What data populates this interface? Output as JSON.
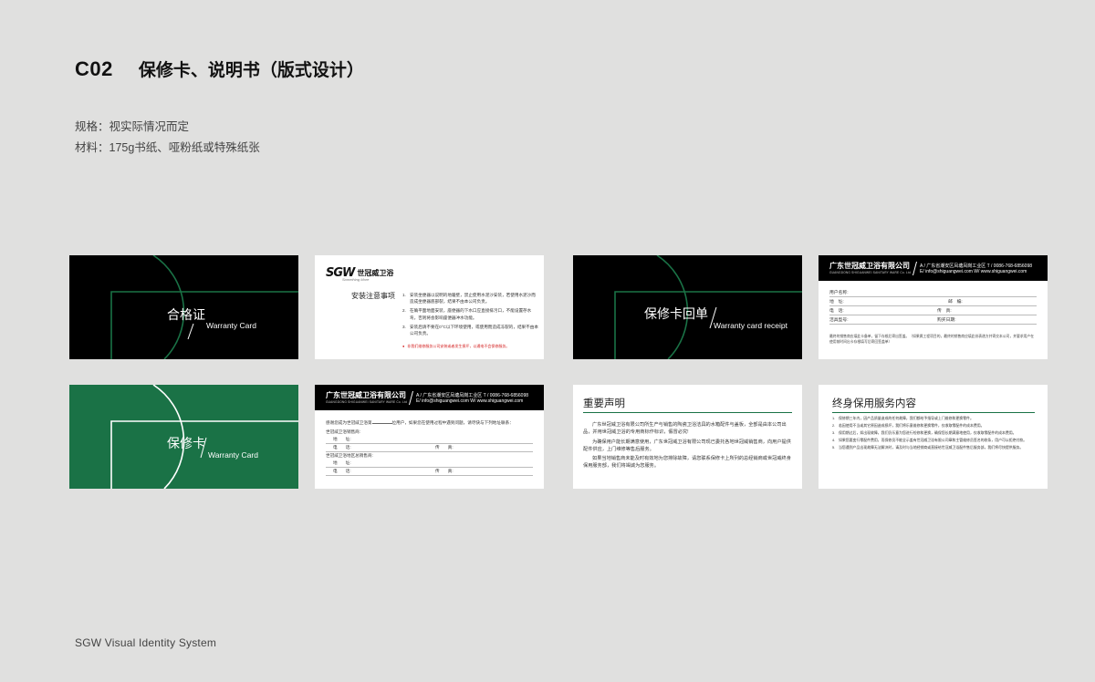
{
  "header": {
    "code": "C02",
    "title": "保修卡、说明书（版式设计）"
  },
  "specs": {
    "size": "规格：视实际情况而定",
    "material": "材料：175g书纸、哑粉纸或特殊纸张"
  },
  "footer": "SGW Visual Identity System",
  "company": {
    "name_cn": "广东世冠威卫浴有限公司",
    "name_en": "GUANGDONG SHIGUANWEI SANITARY WARE Co. Ltd",
    "address": "A / 广东省潮安区凤塘凤岗工业区  T / 0086-768-6856098",
    "web": "E/ info@shiguangwei.com  W/ www.shiguangwei.com"
  },
  "colors": {
    "brand_green": "#1a7246",
    "black": "#000000",
    "warning_red": "#d42222"
  },
  "cards": {
    "certificate": {
      "cn": "合格证",
      "en": "Warranty Card"
    },
    "receipt": {
      "cn": "保修卡回单",
      "en": "Warranty card receipt"
    },
    "warranty": {
      "cn": "保修卡",
      "en": "Warranty Card"
    },
    "install": {
      "logo_mark": "SGW",
      "logo_name": "世冠威卫浴",
      "logo_sub": "Something More",
      "title": "安装注意事项",
      "items": [
        {
          "num": "1.",
          "text": "安装坐便器以说明的地暖壁，禁止使用水泥沙安装，若使用水泥沙而造成坐便器底部裂，结果不由本公司负责。"
        },
        {
          "num": "2.",
          "text": "在确平面地面安装，座便器的下水口应直接排污口，不能设置存水弯，否则将会影响座便器冲水功能。"
        },
        {
          "num": "3.",
          "text": "安装后请不要在0°C以下环境使用，或使用而造成冻裂的，结果不由本公司负责。"
        }
      ],
      "warning": "非我们维修服务公司安装或者发生损坏，以通电不会保修服务。"
    },
    "receipt_form": {
      "rows": [
        [
          "用户名称:",
          ""
        ],
        [
          "地　址:",
          "邮　编:"
        ],
        [
          "电　话:",
          "传　真:"
        ],
        [
          "洁具型号:",
          "购买日期:"
        ]
      ],
      "note": "最终的销售商应填此卡备单，留下存根后寄出签盖。（如果属工程项目的，最终的销售商应填此份表递方并寄交本公司，并要求用户在使用前时间出卡存根填写后寄回签盖单）"
    },
    "warranty_form": {
      "intro_a": "感谢您成为世冠威卫浴第",
      "intro_b": "位用户，如果您在使用过程中遇到问题，请尽快与下列地址联系：",
      "dealer_title": "世冠威卫浴销售商:",
      "region_title": "世冠威卫浴地区总销售商:",
      "addr": "地　　址:",
      "tel": "电　　话:",
      "fax": "传　　真:"
    },
    "statement": {
      "title": "重要声明",
      "paragraphs": [
        "广东世冠威卫浴有限公司所生产与销售的陶瓷卫浴洁具的水箱配件与盖板，全部是由本公司出品，并用世冠威卫浴的专用商标作标识，假冒必究!",
        "为确保用户能长期满意使用，广东世冠威卫浴有限公司现已委托各地世冠威销售商，向用户提供配件供应，上门维修等售后服务。",
        "如果当地销售商未能及时有效地为您排除故障，请您联系保修卡上所列的总经销商或世冠威终身保用服务部，我们将竭诚为您服务。"
      ]
    },
    "service": {
      "title": "终身保用服务内容",
      "items": [
        {
          "num": "1.",
          "text": "保修期三年内，因产品质量造成的任何故障，我们都给予指导或上门维修和更换零件。"
        },
        {
          "num": "2.",
          "text": "若因使用不当或其它原因造成损坏，我们将乐意维修和更换零件，仅收取零配件的成本费用。"
        },
        {
          "num": "3.",
          "text": "保用期过后，如出现故障，我们仍乐意为您进行检修和更换，确保您长期满意地使用，仅收取零配件的成本费用。"
        },
        {
          "num": "4.",
          "text": "如果您要变行零配件费用，而保修员不能全示盖有世冠威卫浴有限公司章和主管维修员签名的收条，用户可以拒绝付款。"
        },
        {
          "num": "5.",
          "text": "当您遇到产品出现故障无法解决时，请及时与当地经销商或直接给世冠威卫浴配件售后服务部，我们将尽快提供服务。"
        }
      ]
    }
  }
}
